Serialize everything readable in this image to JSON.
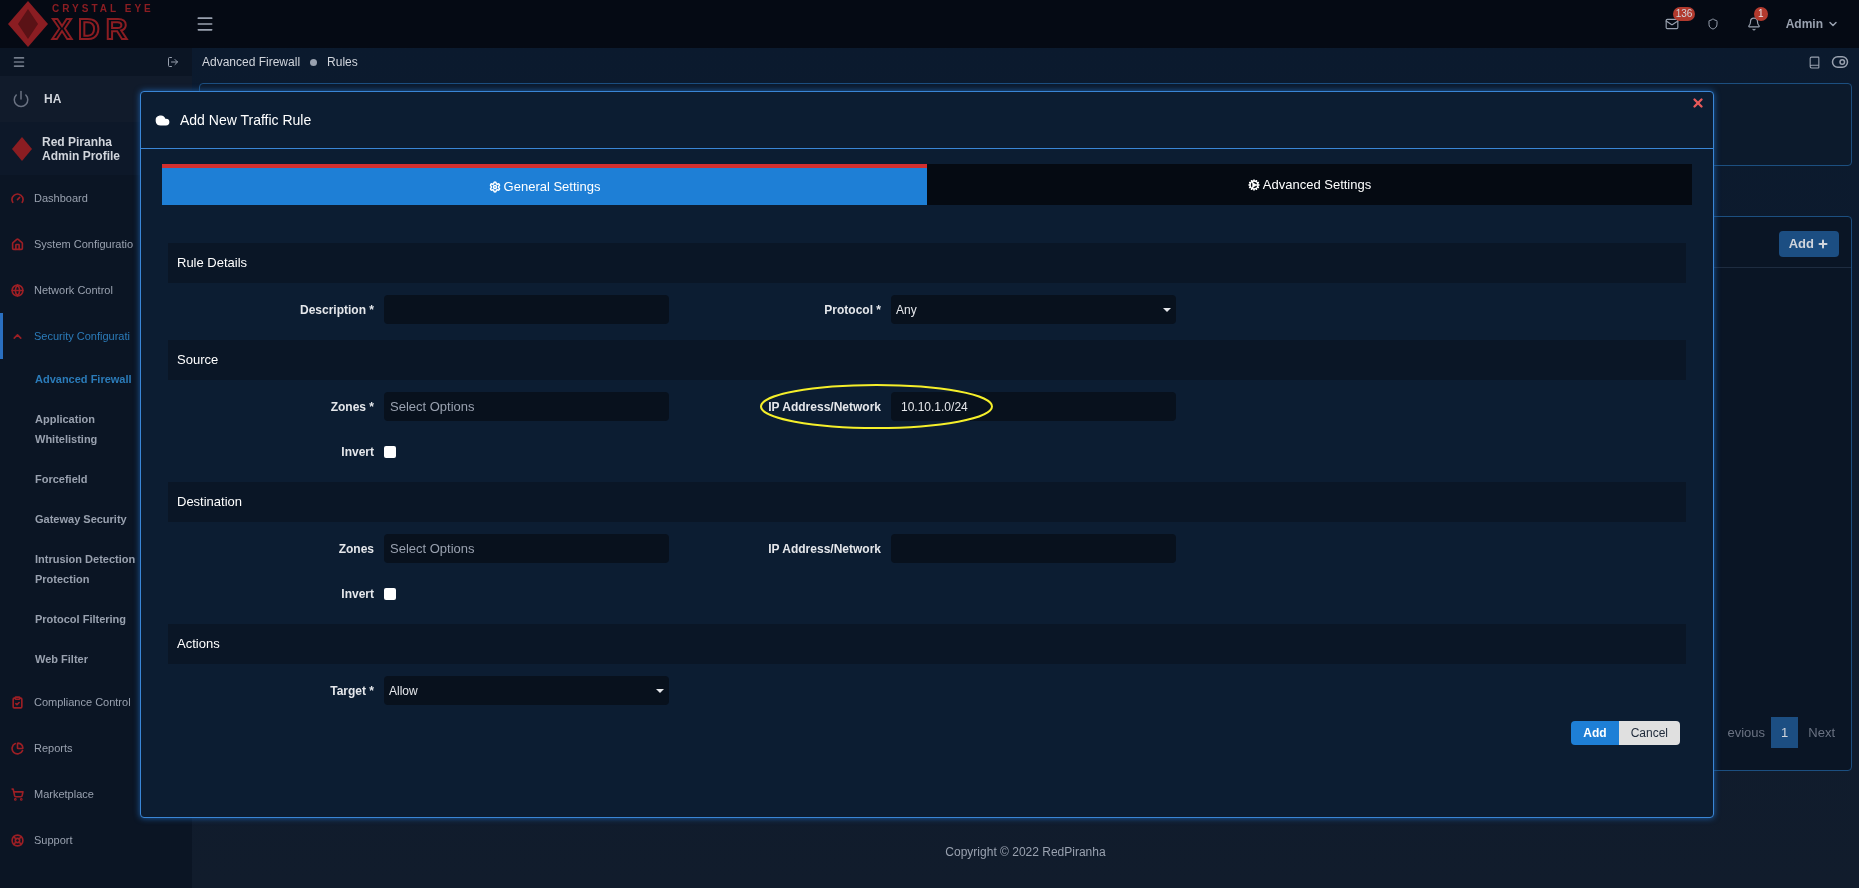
{
  "header": {
    "logo": {
      "tagline": "CRYSTAL EYE",
      "brand": "XDR"
    },
    "mail_count": "136",
    "alert_count": "1",
    "user": "Admin"
  },
  "sidebar": {
    "ha": "HA",
    "profile": {
      "name": "Red Piranha",
      "role": "Admin Profile"
    },
    "items": [
      {
        "label": "Dashboard",
        "selected": false
      },
      {
        "label": "System Configuratio",
        "selected": false
      },
      {
        "label": "Network Control",
        "selected": false
      },
      {
        "label": "Security Configurati",
        "selected": true,
        "expanded": true,
        "children": [
          {
            "label": "Advanced Firewall",
            "selected": true
          },
          {
            "label": "Application Whitelisting",
            "selected": false
          },
          {
            "label": "Forcefield",
            "selected": false
          },
          {
            "label": "Gateway Security",
            "selected": false
          },
          {
            "label": "Intrusion Detection Protection",
            "selected": false
          },
          {
            "label": "Protocol Filtering",
            "selected": false
          },
          {
            "label": "Web Filter",
            "selected": false
          }
        ]
      },
      {
        "label": "Compliance Control",
        "selected": false
      },
      {
        "label": "Reports",
        "selected": false
      },
      {
        "label": "Marketplace",
        "selected": false
      },
      {
        "label": "Support",
        "selected": false
      }
    ]
  },
  "breadcrumb": [
    "Advanced Firewall",
    "Rules"
  ],
  "rules_panel": {
    "add_button": "Add",
    "pagination": {
      "previous": "evious",
      "pages": [
        {
          "label": "1",
          "selected": true
        }
      ],
      "next": "Next"
    }
  },
  "modal": {
    "title": "Add New Traffic Rule",
    "tabs": [
      {
        "label": "General Settings",
        "selected": true
      },
      {
        "label": "Advanced Settings",
        "selected": false
      }
    ],
    "sections": [
      {
        "title": "Rule Details",
        "rows": [
          {
            "fields": [
              {
                "kind": "text",
                "label": "Description *"
              },
              {
                "kind": "select",
                "label": "Protocol *",
                "value": "Any"
              }
            ]
          }
        ]
      },
      {
        "title": "Source",
        "rows": [
          {
            "fields": [
              {
                "kind": "multiselect",
                "label": "Zones *",
                "placeholder": "Select Options"
              },
              {
                "kind": "text",
                "label": "IP Address/Network",
                "value": "10.10.1.0/24",
                "highlighted": true
              }
            ]
          },
          {
            "fields": [
              {
                "kind": "checkbox",
                "label": "Invert",
                "checked": false
              }
            ]
          }
        ]
      },
      {
        "title": "Destination",
        "rows": [
          {
            "fields": [
              {
                "kind": "multiselect",
                "label": "Zones",
                "placeholder": "Select Options"
              },
              {
                "kind": "text",
                "label": "IP Address/Network"
              }
            ]
          },
          {
            "fields": [
              {
                "kind": "checkbox",
                "label": "Invert",
                "checked": false
              }
            ]
          }
        ]
      },
      {
        "title": "Actions",
        "rows": [
          {
            "fields": [
              {
                "kind": "select",
                "label": "Target *",
                "value": "Allow"
              }
            ]
          }
        ]
      }
    ],
    "buttons": [
      {
        "label": "Add",
        "kind": "primary"
      },
      {
        "label": "Cancel",
        "kind": "secondary"
      }
    ]
  },
  "footer": "Copyright © 2022 RedPiranha"
}
